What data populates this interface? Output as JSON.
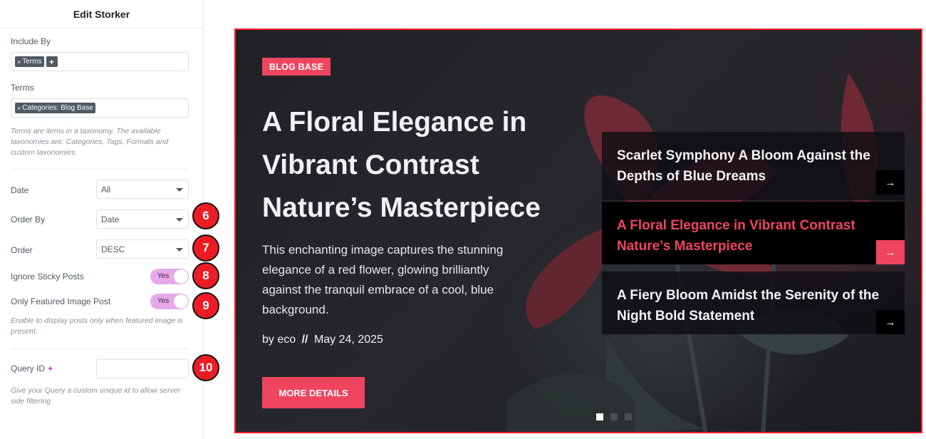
{
  "panel": {
    "title": "Edit Storker",
    "include_by_label": "Include By",
    "include_by_chip": "Terms",
    "terms_label": "Terms",
    "terms_chip": "Categories: Blog Base",
    "terms_help": "Terms are items in a taxonomy. The available taxonomies are: Categories, Tags, Formats and custom taxonomies.",
    "date_label": "Date",
    "date_value": "All",
    "order_by_label": "Order By",
    "order_by_value": "Date",
    "order_label": "Order",
    "order_value": "DESC",
    "ignore_sticky_label": "Ignore Sticky Posts",
    "ignore_sticky_value": "Yes",
    "featured_label": "Only Featured Image Post",
    "featured_value": "Yes",
    "featured_help": "Enable to display posts only when featured image is present.",
    "query_id_label": "Query ID",
    "query_id_value": "",
    "query_help": "Give your Query a custom unique id to allow server side filtering"
  },
  "markers": [
    "6",
    "7",
    "8",
    "9",
    "10"
  ],
  "preview": {
    "badge": "BLOG BASE",
    "title": "A Floral Elegance in Vibrant Contrast Nature’s Masterpiece",
    "excerpt": "This enchanting image captures the stunning elegance of a red flower, glowing brilliantly against the tranquil embrace of a cool, blue background.",
    "meta_by": "by",
    "meta_author": "eco",
    "meta_sep": "//",
    "meta_date": "May 24, 2025",
    "more_label": "MORE DETAILS",
    "cards": [
      {
        "title": "Scarlet Symphony A Bloom Against the Depths of Blue Dreams"
      },
      {
        "title": "A Floral Elegance in Vibrant Contrast Nature’s Masterpiece"
      },
      {
        "title": "A Fiery Bloom Amidst the Serenity of the Night Bold Statement"
      }
    ],
    "active_slide": 1,
    "slide_count": 3
  },
  "colors": {
    "accent": "#f0455f",
    "marker": "#ed1c24",
    "frame": "#ff1a2b",
    "toggle": "#e5a8e8"
  }
}
